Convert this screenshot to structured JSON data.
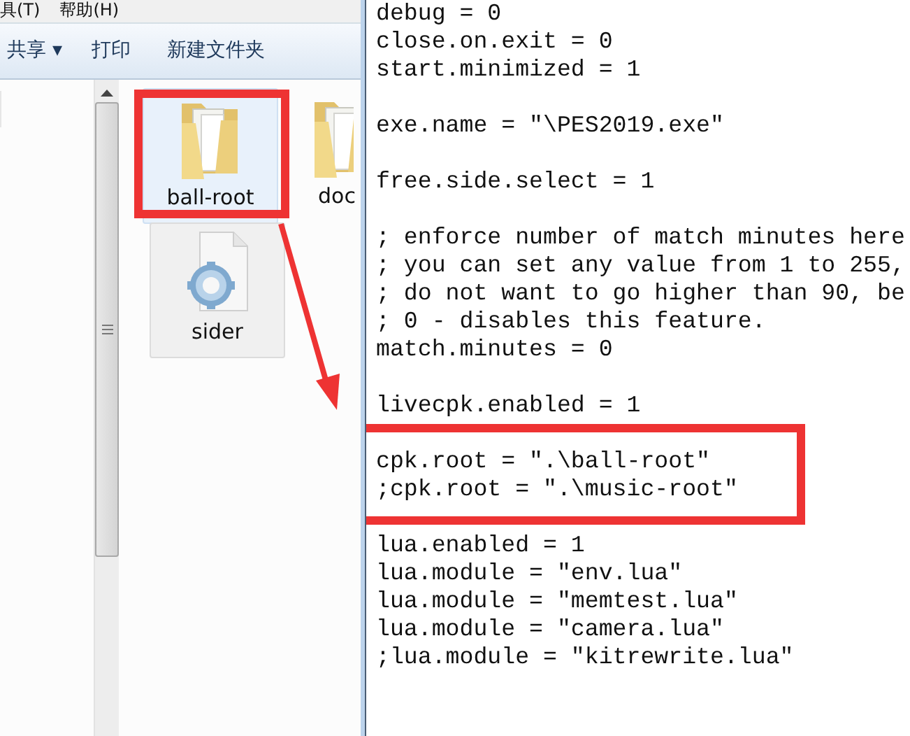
{
  "explorer": {
    "menu": [
      {
        "label": "具(T)"
      },
      {
        "label": "帮助(H)"
      }
    ],
    "toolbar": [
      {
        "label": "共享",
        "caret": "▾"
      },
      {
        "label": "打印"
      },
      {
        "label": "新建文件夹"
      }
    ],
    "files": [
      {
        "name": "ball-root",
        "kind": "folder",
        "selected": true,
        "highlighted": true
      },
      {
        "name": "doc",
        "kind": "folder",
        "selected": false,
        "highlighted": false
      },
      {
        "name": "sider",
        "kind": "settings-file",
        "selected": false,
        "highlighted": false
      }
    ]
  },
  "notepad": {
    "blocks": [
      {
        "lines": [
          "debug = 0",
          "close.on.exit = 0",
          "start.minimized = 1"
        ],
        "highlighted": false
      },
      {
        "lines": [
          "exe.name = \"\\PES2019.exe\""
        ],
        "highlighted": false
      },
      {
        "lines": [
          "free.side.select = 1"
        ],
        "highlighted": false
      },
      {
        "lines": [
          "; enforce number of match minutes here",
          "; you can set any value from 1 to 255,",
          "; do not want to go higher than 90, be",
          "; 0 - disables this feature.",
          "match.minutes = 0"
        ],
        "highlighted": false
      },
      {
        "lines": [
          "livecpk.enabled = 1"
        ],
        "highlighted": false
      },
      {
        "lines": [
          "cpk.root = \".\\ball-root\"",
          ";cpk.root = \".\\music-root\""
        ],
        "highlighted": true
      },
      {
        "lines": [
          "lua.enabled = 1",
          "lua.module = \"env.lua\"",
          "lua.module = \"memtest.lua\"",
          "lua.module = \"camera.lua\"",
          ";lua.module = \"kitrewrite.lua\""
        ],
        "highlighted": false
      }
    ]
  }
}
